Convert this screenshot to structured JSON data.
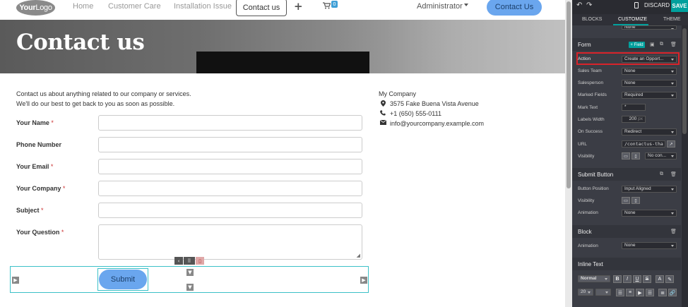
{
  "nav": {
    "logo_bold": "Your",
    "logo_rest": "Logo",
    "links": [
      "Home",
      "Customer Care",
      "Installation Issue"
    ],
    "active": "Contact us",
    "cart_count": "0",
    "user": "Administrator",
    "cta": "Contact Us"
  },
  "hero": {
    "title": "Contact us"
  },
  "intro": {
    "line1": "Contact us about anything related to our company or services.",
    "line2": "We'll do our best to get back to you as soon as possible."
  },
  "form": {
    "fields": [
      {
        "label": "Your Name",
        "required": "*"
      },
      {
        "label": "Phone Number",
        "required": ""
      },
      {
        "label": "Your Email",
        "required": "*"
      },
      {
        "label": "Your Company",
        "required": "*"
      },
      {
        "label": "Subject",
        "required": "*"
      },
      {
        "label": "Your Question",
        "required": "*"
      }
    ],
    "submit": "Submit"
  },
  "company": {
    "name": "My Company",
    "address": "3575 Fake Buena Vista Avenue",
    "phone": "+1 (650) 555-0111",
    "email": "info@yourcompany.example.com"
  },
  "panel": {
    "discard": "DISCARD",
    "save": "SAVE",
    "tabs": [
      "BLOCKS",
      "CUSTOMIZE",
      "THEME"
    ],
    "top_select": "None",
    "form_section": {
      "title": "Form",
      "add_field": "+ Field",
      "rows": [
        {
          "label": "Action",
          "value": "Create an Opport..."
        },
        {
          "label": "Sales Team",
          "value": "None"
        },
        {
          "label": "Salesperson",
          "value": "None"
        },
        {
          "label": "Marked Fields",
          "value": "Required"
        },
        {
          "label": "Mark Text",
          "value": "*"
        },
        {
          "label": "Labels Width",
          "value": "200",
          "unit": "px"
        },
        {
          "label": "On Success",
          "value": "Redirect"
        },
        {
          "label": "URL",
          "value": "/contactus-tha"
        },
        {
          "label": "Visibility",
          "value": "No con..."
        }
      ]
    },
    "submit_section": {
      "title": "Submit Button",
      "rows": [
        {
          "label": "Button Position",
          "value": "Input Aligned"
        },
        {
          "label": "Visibility",
          "value": ""
        },
        {
          "label": "Animation",
          "value": "None"
        }
      ]
    },
    "block_section": {
      "title": "Block",
      "rows": [
        {
          "label": "Animation",
          "value": "None"
        }
      ]
    },
    "inline_section": {
      "title": "Inline Text",
      "style_select": "Normal",
      "size_select": "20",
      "format_buttons": [
        "B",
        "I",
        "U",
        "S",
        "A"
      ]
    }
  },
  "colors": {
    "accent": "#00a09d",
    "primary_button": "#6aa6ee",
    "highlight": "#d9232a",
    "selection": "#3cc1c8"
  }
}
